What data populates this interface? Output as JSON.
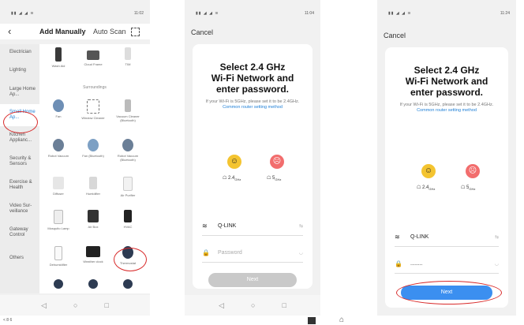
{
  "screen1": {
    "status_time": "11:02",
    "back_icon": "chevron-left-icon",
    "tab_manual": "Add Manually",
    "tab_scan": "Auto Scan",
    "categories": [
      "Electrician",
      "Lighting",
      "Large Home Ap...",
      "Small Home Ap...",
      "Kitchen Applianc...",
      "Security & Sensors",
      "Exercise & Health",
      "Video Sur- veillance",
      "Gateway Control",
      "Others"
    ],
    "selected_category": "Small Home Ap...",
    "section_title": "Surroundings",
    "devices_top": [
      "Wash Aid",
      "Cloud Frame",
      "TIM"
    ],
    "devices": [
      "Fan",
      "Window Cleaner",
      "Vacuum Cleaner (Bluetooth)",
      "Robot Vacuum",
      "Fan (Bluetooth)",
      "Robot Vacuum (Bluetooth)",
      "Diffuser",
      "Humidifier",
      "Air Purifier",
      "Mosquito Lamp",
      "Air Box",
      "HVAC",
      "Dehumidifier",
      "Weather clock",
      "Thermostat"
    ],
    "highlight_color": "#d82a2a",
    "accent_color": "#1e7fd6"
  },
  "screen2": {
    "status_time": "11:04",
    "cancel": "Cancel",
    "title_line1": "Select 2.4 GHz",
    "title_line2": "Wi-Fi Network and",
    "title_line3": "enter password.",
    "note_prefix": "If your Wi-Fi is 5GHz, please set it to be 2.4GHz.",
    "note_link": "Common router setting method",
    "band_good": "2.4",
    "band_bad": "5",
    "band_unit": "GHz",
    "wifi_name": "Q-LINK",
    "password_placeholder": "Password",
    "next": "Next"
  },
  "screen3": {
    "status_time": "11:24",
    "cancel": "Cancel",
    "title_line1": "Select 2.4 GHz",
    "title_line2": "Wi-Fi Network and",
    "title_line3": "enter password.",
    "note_prefix": "If your Wi-Fi is 5GHz, please set it to be 2.4GHz.",
    "note_link": "Common router setting method",
    "band_good": "2.4",
    "band_bad": "5",
    "band_unit": "GHz",
    "wifi_name": "Q-LINK",
    "password_value": "........",
    "next": "Next",
    "button_color": "#3b8ff0"
  },
  "footer": {
    "left_text": "< 8 6"
  }
}
